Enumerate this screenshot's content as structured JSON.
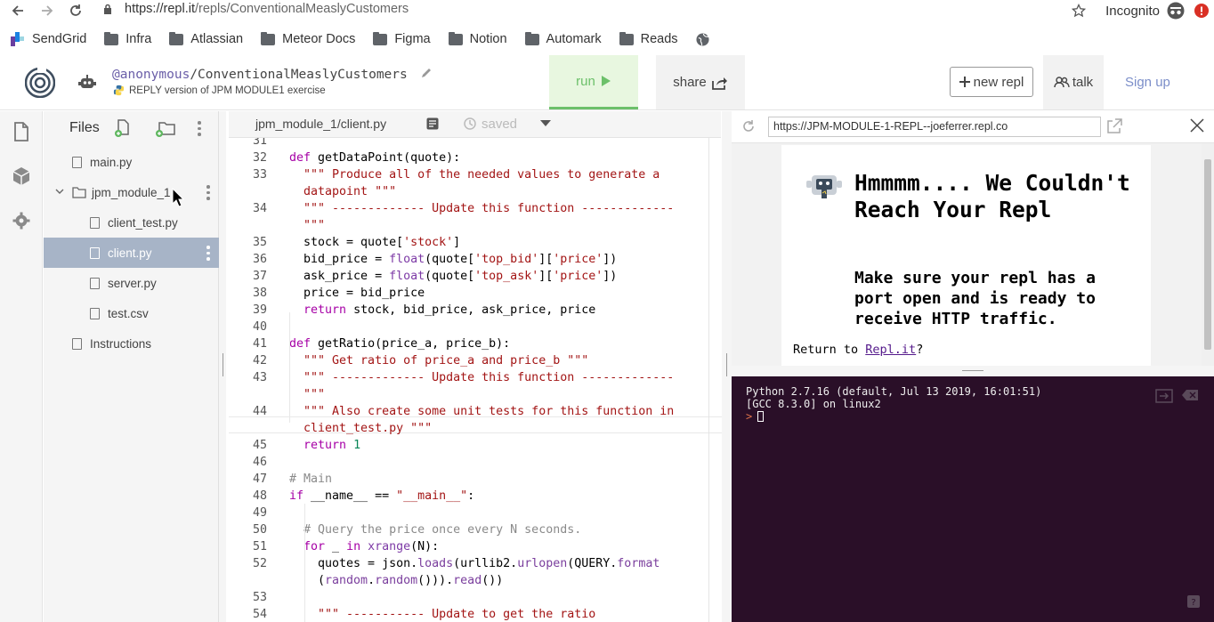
{
  "browser": {
    "url_domain": "https://repl.it",
    "url_path": "/repls/ConventionalMeaslyCustomers",
    "mode_label": "Incognito"
  },
  "bookmarks": [
    "SendGrid",
    "Infra",
    "Atlassian",
    "Meteor Docs",
    "Figma",
    "Notion",
    "Automark",
    "Reads"
  ],
  "header": {
    "username": "@anonymous",
    "repl_name": "/ConventionalMeaslyCustomers",
    "description": "REPLY version of JPM MODULE1 exercise",
    "run_label": "run",
    "share_label": "share",
    "new_repl_label": "new repl",
    "talk_label": "talk",
    "signup_label": "Sign up"
  },
  "files": {
    "title": "Files",
    "items": [
      {
        "name": "main.py",
        "type": "file"
      },
      {
        "name": "jpm_module_1",
        "type": "folder"
      },
      {
        "name": "client_test.py",
        "type": "file"
      },
      {
        "name": "client.py",
        "type": "file",
        "selected": true
      },
      {
        "name": "server.py",
        "type": "file"
      },
      {
        "name": "test.csv",
        "type": "file"
      },
      {
        "name": "Instructions",
        "type": "file"
      }
    ]
  },
  "editor": {
    "tab_label": "jpm_module_1/client.py",
    "status": "saved",
    "lines": [
      {
        "n": "31",
        "t": ""
      },
      {
        "n": "32",
        "t": "def getDataPoint(quote):"
      },
      {
        "n": "33",
        "t": "  \"\"\" Produce all of the needed values to generate a"
      },
      {
        "n": "",
        "t": "  datapoint \"\"\""
      },
      {
        "n": "34",
        "t": "  \"\"\" ------------- Update this function -------------"
      },
      {
        "n": "",
        "t": "  \"\"\""
      },
      {
        "n": "35",
        "t": "  stock = quote['stock']"
      },
      {
        "n": "36",
        "t": "  bid_price = float(quote['top_bid']['price'])"
      },
      {
        "n": "37",
        "t": "  ask_price = float(quote['top_ask']['price'])"
      },
      {
        "n": "38",
        "t": "  price = bid_price"
      },
      {
        "n": "39",
        "t": "  return stock, bid_price, ask_price, price"
      },
      {
        "n": "40",
        "t": ""
      },
      {
        "n": "41",
        "t": "def getRatio(price_a, price_b):"
      },
      {
        "n": "42",
        "t": "  \"\"\" Get ratio of price_a and price_b \"\"\""
      },
      {
        "n": "43",
        "t": "  \"\"\" ------------- Update this function -------------"
      },
      {
        "n": "",
        "t": "  \"\"\""
      },
      {
        "n": "44",
        "t": "  \"\"\" Also create some unit tests for this function in"
      },
      {
        "n": "",
        "t": "  client_test.py \"\"\""
      },
      {
        "n": "45",
        "t": "  return 1"
      },
      {
        "n": "46",
        "t": ""
      },
      {
        "n": "47",
        "t": "# Main"
      },
      {
        "n": "48",
        "t": "if __name__ == \"__main__\":"
      },
      {
        "n": "49",
        "t": ""
      },
      {
        "n": "50",
        "t": "  # Query the price once every N seconds."
      },
      {
        "n": "51",
        "t": "  for _ in xrange(N):"
      },
      {
        "n": "52",
        "t": "    quotes = json.loads(urllib2.urlopen(QUERY.format"
      },
      {
        "n": "",
        "t": "    (random.random())).read())"
      },
      {
        "n": "53",
        "t": ""
      },
      {
        "n": "54",
        "t": "    \"\"\" ----------- Update to get the ratio"
      }
    ]
  },
  "webview": {
    "url": "https://JPM-MODULE-1-REPL--joeferrer.repl.co",
    "heading": "Hmmmm.... We Couldn't Reach Your Repl",
    "message": "Make sure your repl has a port open and is ready to receive HTTP traffic.",
    "return_prefix": "Return to ",
    "return_link": "Repl.it",
    "return_suffix": "?"
  },
  "console": {
    "line1": "Python 2.7.16 (default, Jul 13 2019, 16:01:51)",
    "line2": "[GCC 8.3.0] on linux2",
    "prompt": ">"
  }
}
